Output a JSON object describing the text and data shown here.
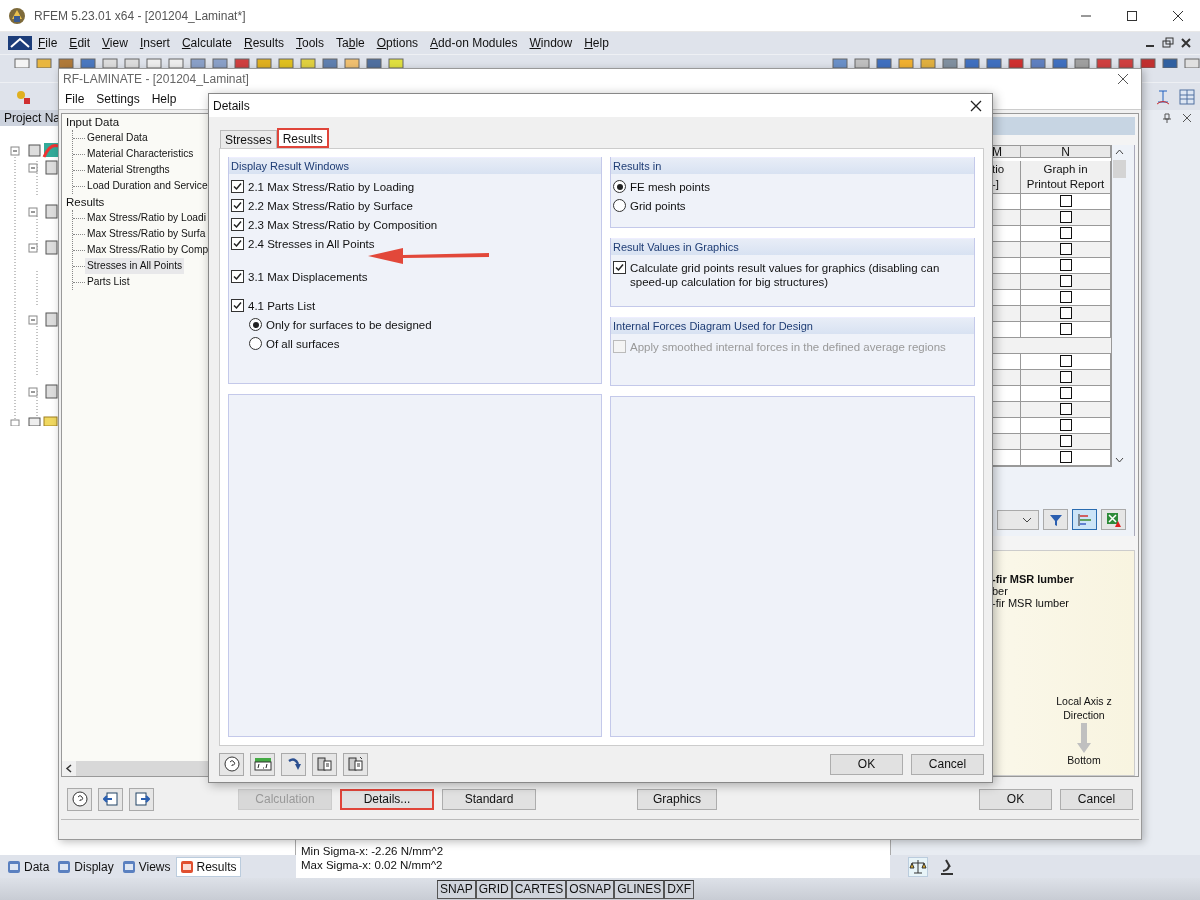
{
  "app_window": {
    "title": "RFEM 5.23.01 x64 - [201204_Laminat*]",
    "menu": [
      {
        "key": "F",
        "post": "ile"
      },
      {
        "key": "E",
        "post": "dit"
      },
      {
        "key": "V",
        "post": "iew"
      },
      {
        "key": "I",
        "post": "nsert"
      },
      {
        "key": "C",
        "post": "alculate"
      },
      {
        "key": "R",
        "post": "esults"
      },
      {
        "key": "T",
        "post": "ools"
      },
      {
        "pre": "Ta",
        "key": "b",
        "post": "le"
      },
      {
        "key": "O",
        "post": "ptions"
      },
      {
        "key": "A",
        "post": "dd-on Modules"
      },
      {
        "key": "W",
        "post": "indow"
      },
      {
        "key": "H",
        "post": "elp"
      }
    ],
    "panel_title": "Project Na",
    "bottom_tabs": [
      {
        "label": "Data",
        "selected": false
      },
      {
        "label": "Display",
        "selected": false
      },
      {
        "label": "Views",
        "selected": false
      },
      {
        "label": "Results",
        "selected": true
      }
    ],
    "info_lines": [
      "Min Sigma-x: -2.26 N/mm^2",
      "Max Sigma-x: 0.02 N/mm^2"
    ],
    "status_toggles": [
      "SNAP",
      "GRID",
      "CARTES",
      "OSNAP",
      "GLINES",
      "DXF"
    ]
  },
  "laminate_window": {
    "title": "RF-LAMINATE - [201204_Laminat]",
    "menu": [
      "File",
      "Settings",
      "Help"
    ],
    "nav": [
      {
        "label": "Input Data",
        "children": [
          {
            "label": "General Data",
            "selected": false
          },
          {
            "label": "Material Characteristics",
            "selected": false
          },
          {
            "label": "Material Strengths",
            "selected": false
          },
          {
            "label": "Load Duration and Service",
            "selected": false
          }
        ]
      },
      {
        "label": "Results",
        "children": [
          {
            "label": "Max Stress/Ratio by Loadi",
            "selected": false
          },
          {
            "label": "Max Stress/Ratio by Surfa",
            "selected": false
          },
          {
            "label": "Max Stress/Ratio by Comp",
            "selected": false
          },
          {
            "label": "Stresses in All Points",
            "selected": true
          },
          {
            "label": "Parts List",
            "selected": false
          }
        ]
      }
    ],
    "table": {
      "columns": [
        {
          "letter": "M",
          "heading": [
            "tio",
            "-]"
          ]
        },
        {
          "letter": "N",
          "heading": [
            "Graph in",
            "Printout Report"
          ]
        }
      ],
      "rows": [
        {
          "kind": "check",
          "checked": false
        },
        {
          "kind": "check",
          "checked": false
        },
        {
          "kind": "check",
          "checked": false
        },
        {
          "kind": "check",
          "checked": false
        },
        {
          "kind": "check",
          "checked": false
        },
        {
          "kind": "check",
          "checked": false
        },
        {
          "kind": "check",
          "checked": false
        },
        {
          "kind": "check",
          "checked": false
        },
        {
          "kind": "check",
          "checked": false
        },
        {
          "kind": "blank"
        },
        {
          "kind": "check",
          "checked": false
        },
        {
          "kind": "check",
          "checked": false
        },
        {
          "kind": "check",
          "checked": false
        },
        {
          "kind": "check",
          "checked": false
        },
        {
          "kind": "check",
          "checked": false
        },
        {
          "kind": "check",
          "checked": false
        },
        {
          "kind": "check",
          "checked": false
        }
      ]
    },
    "info_panel": {
      "lines": [
        {
          "text": "-fir MSR lumber",
          "bold": true
        },
        {
          "text": "ber",
          "bold": false
        },
        {
          "text": "-fir MSR lumber",
          "bold": false
        }
      ],
      "axis_label": [
        "Local Axis z",
        "Direction"
      ],
      "axis_end": "Bottom"
    },
    "buttons": [
      {
        "label": "Calculation",
        "disabled": true,
        "highlighted": false
      },
      {
        "label": "Details...",
        "disabled": false,
        "highlighted": true
      },
      {
        "label": "Standard",
        "disabled": false,
        "highlighted": false
      },
      {
        "label": "Graphics",
        "disabled": false,
        "highlighted": false
      }
    ],
    "dialog_buttons": [
      "OK",
      "Cancel"
    ]
  },
  "details_dialog": {
    "title": "Details",
    "tabs": [
      {
        "label": "Stresses",
        "selected": false,
        "highlighted": false
      },
      {
        "label": "Results",
        "selected": true,
        "highlighted": true
      }
    ],
    "left_group": {
      "title": "Display Result Windows",
      "items": [
        {
          "kind": "checkbox",
          "label": "2.1 Max Stress/Ratio by Loading",
          "checked": true
        },
        {
          "kind": "checkbox",
          "label": "2.2 Max Stress/Ratio by Surface",
          "checked": true
        },
        {
          "kind": "checkbox",
          "label": "2.3 Max Stress/Ratio by Composition",
          "checked": true
        },
        {
          "kind": "checkbox",
          "label": "2.4 Stresses in All Points",
          "checked": true
        },
        {
          "kind": "checkbox",
          "label": "3.1 Max Displacements",
          "checked": true
        },
        {
          "kind": "checkbox",
          "label": "4.1 Parts List",
          "checked": true
        },
        {
          "kind": "radio",
          "label": "Only for surfaces to be designed",
          "selected": true
        },
        {
          "kind": "radio",
          "label": "Of all surfaces",
          "selected": false
        }
      ]
    },
    "right_groups": [
      {
        "title": "Results in",
        "items": [
          {
            "kind": "radio",
            "label": "FE mesh points",
            "selected": true
          },
          {
            "kind": "radio",
            "label": "Grid points",
            "selected": false
          }
        ]
      },
      {
        "title": "Result Values in Graphics",
        "items": [
          {
            "kind": "checkbox",
            "label": "Calculate grid points result values for graphics (disabling can speed-up calculation for big structures)",
            "checked": true,
            "disabled": false
          }
        ]
      },
      {
        "title": "Internal Forces Diagram Used for Design",
        "items": [
          {
            "kind": "checkbox",
            "label": "Apply smoothed internal forces in the defined average regions",
            "checked": false,
            "disabled": true
          }
        ]
      }
    ],
    "buttons": [
      "OK",
      "Cancel"
    ]
  }
}
